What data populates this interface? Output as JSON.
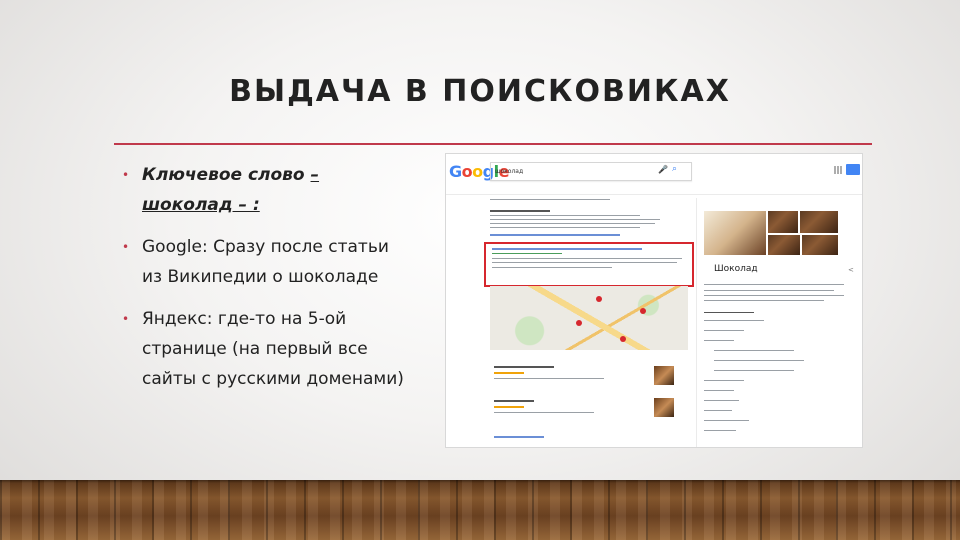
{
  "slide": {
    "title": "ВЫДАЧА В ПОИСКОВИКАХ",
    "bullets": [
      {
        "prefix": "Ключевое слово ",
        "emph": "– шоколад – : "
      },
      {
        "text": "Google: Сразу после статьи из Википедии о шоколаде"
      },
      {
        "text": "Яндекс: где-то на 5-ой странице (на первый все сайты с русскими доменами)"
      }
    ],
    "bullet_symbol": "•"
  },
  "screenshot": {
    "logo": "Google",
    "query": "шоколад",
    "kp_title": "Шоколад",
    "colors": {
      "highlight": "#d6272e",
      "accent": "#c0394b",
      "link": "#1a0dab"
    }
  }
}
